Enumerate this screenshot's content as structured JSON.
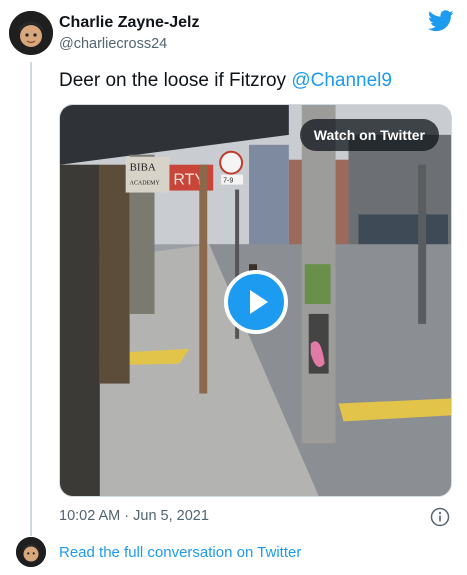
{
  "author": {
    "name": "Charlie Zayne-Jelz",
    "handle": "@charliecross24"
  },
  "tweet": {
    "text": "Deer on the loose if Fitzroy ",
    "mention": "@Channel9"
  },
  "media": {
    "watch_label": "Watch on Twitter",
    "scene_signs": [
      "BIBA",
      "ACADEMY",
      "RTY",
      "7-9"
    ]
  },
  "meta": {
    "timestamp": "10:02 AM · Jun 5, 2021"
  },
  "footer": {
    "read_link": "Read the full conversation on Twitter"
  },
  "colors": {
    "accent": "#1d9bf0",
    "text": "#0f1419",
    "muted": "#536471"
  },
  "icons": [
    "twitter-bird-icon",
    "play-icon",
    "info-icon"
  ]
}
